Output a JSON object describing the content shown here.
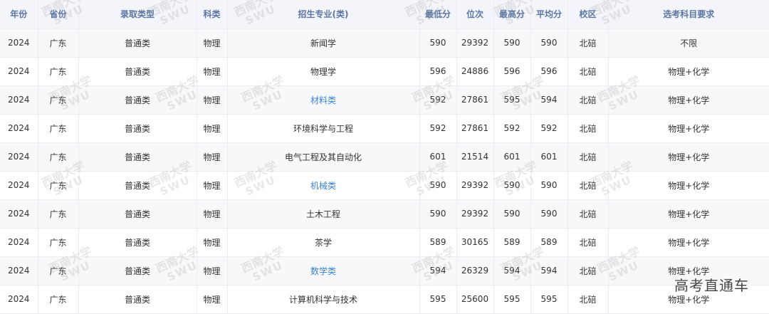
{
  "table": {
    "headers": [
      "年份",
      "省份",
      "录取类型",
      "科类",
      "招生专业(类)",
      "最低分",
      "位次",
      "最高分",
      "平均分",
      "校区",
      "选考科目要求"
    ],
    "rows": [
      {
        "year": "2024",
        "province": "广东",
        "admission_type": "普通类",
        "subject": "物理",
        "major": "新闻学",
        "min_score": "590",
        "rank": "29392",
        "max_score": "590",
        "avg_score": "590",
        "campus": "北碚",
        "requirement": "不限",
        "link": false
      },
      {
        "year": "2024",
        "province": "广东",
        "admission_type": "普通类",
        "subject": "物理",
        "major": "物理学",
        "min_score": "596",
        "rank": "24886",
        "max_score": "596",
        "avg_score": "596",
        "campus": "北碚",
        "requirement": "物理+化学",
        "link": false
      },
      {
        "year": "2024",
        "province": "广东",
        "admission_type": "普通类",
        "subject": "物理",
        "major": "材料类",
        "min_score": "592",
        "rank": "27861",
        "max_score": "595",
        "avg_score": "594",
        "campus": "北碚",
        "requirement": "物理+化学",
        "link": true
      },
      {
        "year": "2024",
        "province": "广东",
        "admission_type": "普通类",
        "subject": "物理",
        "major": "环境科学与工程",
        "min_score": "592",
        "rank": "27861",
        "max_score": "592",
        "avg_score": "592",
        "campus": "北碚",
        "requirement": "物理+化学",
        "link": false
      },
      {
        "year": "2024",
        "province": "广东",
        "admission_type": "普通类",
        "subject": "物理",
        "major": "电气工程及其自动化",
        "min_score": "601",
        "rank": "21514",
        "max_score": "601",
        "avg_score": "601",
        "campus": "北碚",
        "requirement": "物理+化学",
        "link": false
      },
      {
        "year": "2024",
        "province": "广东",
        "admission_type": "普通类",
        "subject": "物理",
        "major": "机械类",
        "min_score": "590",
        "rank": "29392",
        "max_score": "590",
        "avg_score": "590",
        "campus": "北碚",
        "requirement": "物理+化学",
        "link": true
      },
      {
        "year": "2024",
        "province": "广东",
        "admission_type": "普通类",
        "subject": "物理",
        "major": "土木工程",
        "min_score": "590",
        "rank": "29392",
        "max_score": "590",
        "avg_score": "590",
        "campus": "北碚",
        "requirement": "物理+化学",
        "link": false
      },
      {
        "year": "2024",
        "province": "广东",
        "admission_type": "普通类",
        "subject": "物理",
        "major": "茶学",
        "min_score": "589",
        "rank": "30165",
        "max_score": "589",
        "avg_score": "589",
        "campus": "北碚",
        "requirement": "物理+化学",
        "link": false
      },
      {
        "year": "2024",
        "province": "广东",
        "admission_type": "普通类",
        "subject": "物理",
        "major": "数学类",
        "min_score": "594",
        "rank": "26329",
        "max_score": "594",
        "avg_score": "594",
        "campus": "北碚",
        "requirement": "物理+化学",
        "link": true
      },
      {
        "year": "2024",
        "province": "广东",
        "admission_type": "普通类",
        "subject": "物理",
        "major": "计算机科学与技术",
        "min_score": "595",
        "rank": "25600",
        "max_score": "595",
        "avg_score": "595",
        "campus": "北碚",
        "requirement": "物理+化学",
        "link": false
      }
    ]
  },
  "watermark": {
    "line1": "西南大学",
    "line2": "SWU"
  },
  "brand": "高考直通车",
  "colors": {
    "header_bg": "#f3f5fa",
    "header_text": "#5c76a4",
    "link": "#3a82d6",
    "border": "#ececf2"
  }
}
